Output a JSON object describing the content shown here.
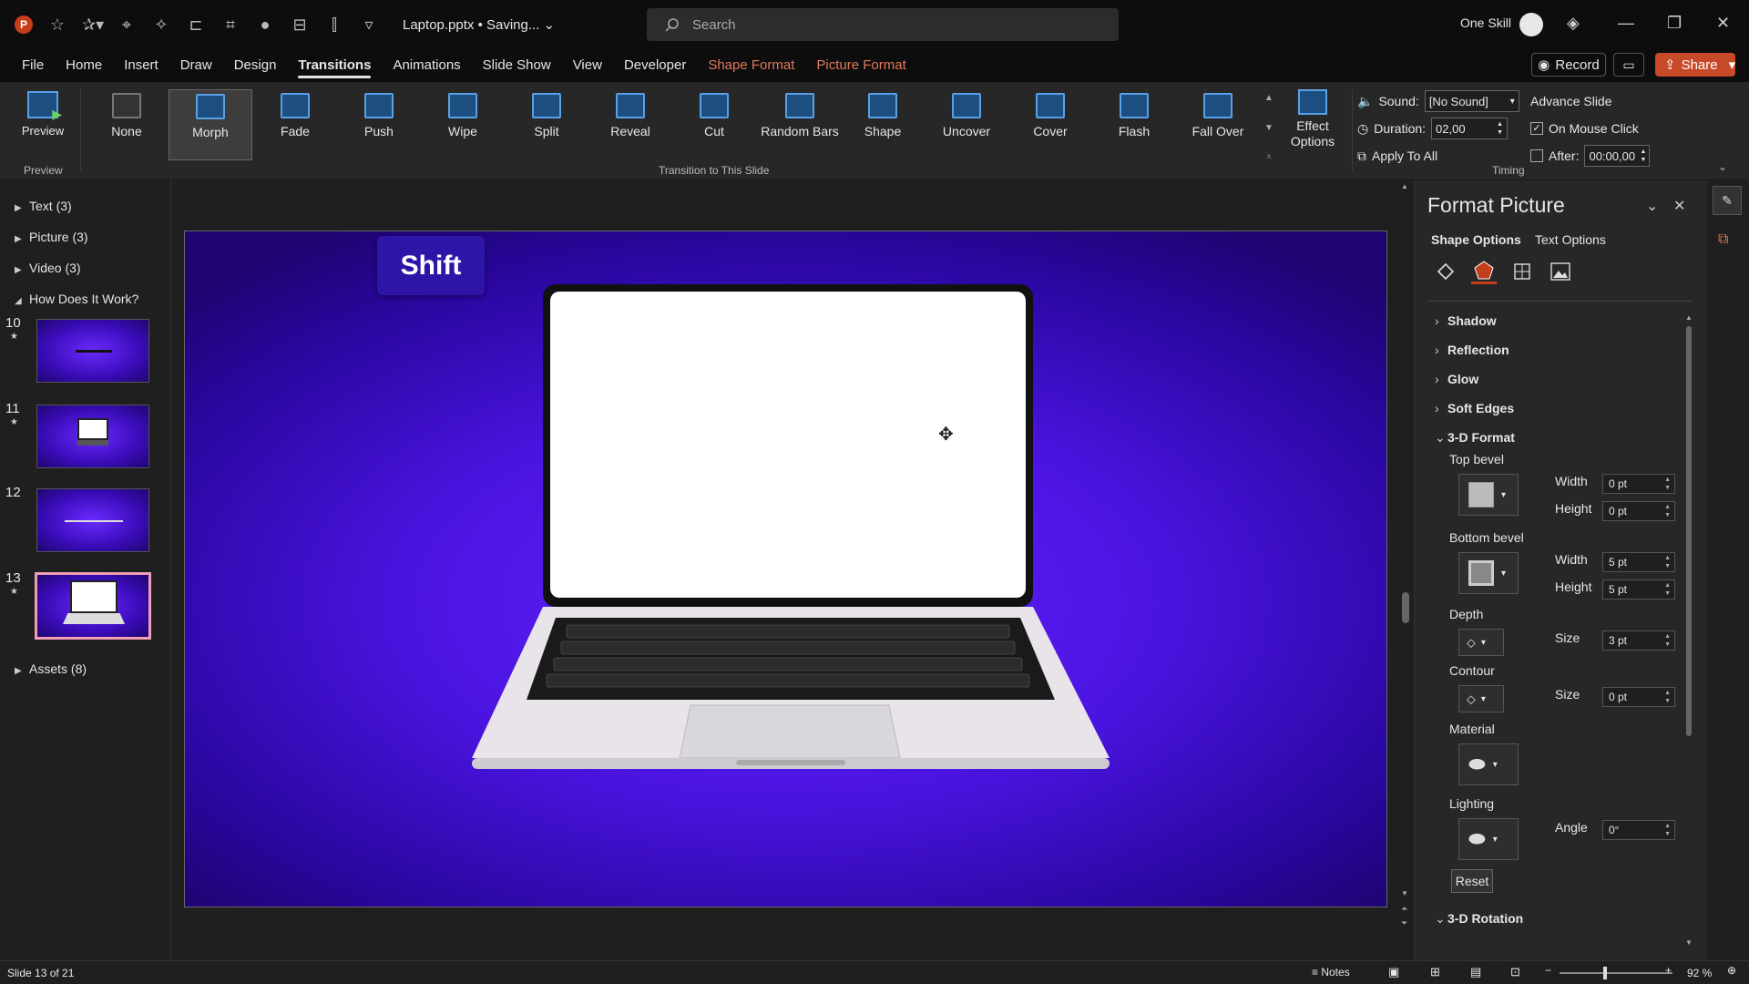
{
  "titlebar": {
    "filename": "Laptop.pptx • Saving...",
    "search_placeholder": "Search",
    "user_name": "One Skill"
  },
  "tabs": [
    "File",
    "Home",
    "Insert",
    "Draw",
    "Design",
    "Transitions",
    "Animations",
    "Slide Show",
    "View",
    "Developer",
    "Shape Format",
    "Picture Format"
  ],
  "active_tab": "Transitions",
  "header_buttons": {
    "record": "Record",
    "share": "Share"
  },
  "ribbon": {
    "preview_label": "Preview",
    "preview_group": "Preview",
    "transition_group": "Transition to This Slide",
    "transitions": [
      "None",
      "Morph",
      "Fade",
      "Push",
      "Wipe",
      "Split",
      "Reveal",
      "Cut",
      "Random Bars",
      "Shape",
      "Uncover",
      "Cover",
      "Flash",
      "Fall Over"
    ],
    "selected_transition": "Morph",
    "effect_options": "Effect Options",
    "timing": {
      "sound_label": "Sound:",
      "sound_value": "[No Sound]",
      "duration_label": "Duration:",
      "duration_value": "02,00",
      "apply_all": "Apply To All",
      "advance_label": "Advance Slide",
      "on_mouse_click": "On Mouse Click",
      "on_mouse_click_checked": true,
      "after_label": "After:",
      "after_value": "00:00,00",
      "after_checked": false,
      "group": "Timing"
    }
  },
  "slides_panel": {
    "sections": [
      {
        "label": "Text (3)",
        "expanded": false
      },
      {
        "label": "Picture (3)",
        "expanded": false
      },
      {
        "label": "Video (3)",
        "expanded": false
      },
      {
        "label": "How Does It Work?",
        "expanded": true
      },
      {
        "label": "Assets (8)",
        "expanded": false
      }
    ],
    "slides": [
      {
        "num": "10",
        "star": "★"
      },
      {
        "num": "11",
        "star": "★"
      },
      {
        "num": "12",
        "star": ""
      },
      {
        "num": "13",
        "star": "★",
        "selected": true
      }
    ]
  },
  "slide": {
    "shift_label": "Shift"
  },
  "format_pane": {
    "title": "Format Picture",
    "tab_shape": "Shape Options",
    "tab_text": "Text Options",
    "sections": [
      "Shadow",
      "Reflection",
      "Glow",
      "Soft Edges",
      "3-D Format"
    ],
    "top_bevel": "Top bevel",
    "bottom_bevel": "Bottom bevel",
    "width_label": "Width",
    "height_label": "Height",
    "top_width": "0 pt",
    "top_height": "0 pt",
    "bottom_width": "5 pt",
    "bottom_height": "5 pt",
    "depth": "Depth",
    "depth_size": "3 pt",
    "contour": "Contour",
    "contour_size": "0 pt",
    "size_label": "Size",
    "material": "Material",
    "lighting": "Lighting",
    "angle_label": "Angle",
    "angle_value": "0°",
    "reset": "Reset",
    "rotation": "3-D Rotation"
  },
  "statusbar": {
    "slide_info": "Slide 13 of 21",
    "notes": "Notes",
    "zoom": "92 %"
  },
  "colors": {
    "accent": "#c43e1c",
    "slide_bg": "#5a1cff",
    "context_tab": "#e0795c",
    "selected_thumb": "#f29eb6"
  }
}
